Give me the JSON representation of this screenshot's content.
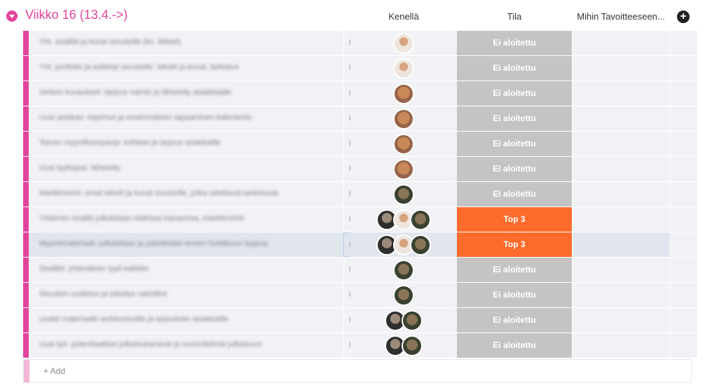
{
  "group": {
    "title": "Viikko 16 (13.4.->)"
  },
  "columns": {
    "person": "Kenellä",
    "status": "Tila",
    "goal": "Mihin Tavoitteeseen..."
  },
  "rows": [
    {
      "name": "Yht. sisällöt ja kuvat sivustolle (ks. liitteet)",
      "avatars": [
        "av-a"
      ],
      "status": "Ei aloitettu",
      "status_type": "default",
      "selected": false
    },
    {
      "name": "Yht. portfolio ja esittelyt sivustolle: tekstit ja kuvat, tarkistus",
      "avatars": [
        "av-a"
      ],
      "status": "Ei aloitettu",
      "status_type": "default",
      "selected": false
    },
    {
      "name": "Verkon kuvaukset: tarjous valmis ja lähetetty asiakkaalle",
      "avatars": [
        "av-b"
      ],
      "status": "Ei aloitettu",
      "status_type": "default",
      "selected": false
    },
    {
      "name": "Uusi asiakas: sopimus ja ensimmäinen tapaaminen kalenteriin",
      "avatars": [
        "av-b"
      ],
      "status": "Ei aloitettu",
      "status_type": "default",
      "selected": false
    },
    {
      "name": "Toinen myyntikampanja: kohteet ja tarjous asiakkaille",
      "avatars": [
        "av-b"
      ],
      "status": "Ei aloitettu",
      "status_type": "default",
      "selected": false
    },
    {
      "name": "Uusi tyyliopas: lähetetty",
      "avatars": [
        "av-b"
      ],
      "status": "Ei aloitettu",
      "status_type": "default",
      "selected": false
    },
    {
      "name": "Markkinointi: omat tekstit ja kuvat sivustolle, jotka odottavat tarkistusta",
      "avatars": [
        "av-c"
      ],
      "status": "Ei aloitettu",
      "status_type": "default",
      "selected": false
    },
    {
      "name": "Yhteinen sisältö julkaistaan kaikissa kanavissa, markkinointi",
      "avatars": [
        "av-d",
        "av-a",
        "av-c"
      ],
      "status": "Top 3",
      "status_type": "top",
      "selected": false
    },
    {
      "name": "Myyntimateriaali: julkaistaan ja päivitetään ennen huhtikuun loppua",
      "avatars": [
        "av-d",
        "av-a",
        "av-c"
      ],
      "status": "Top 3",
      "status_type": "top",
      "selected": true
    },
    {
      "name": "Sisällöt: yhtenäinen tyyli kaikkiin",
      "avatars": [
        "av-c"
      ],
      "status": "Ei aloitettu",
      "status_type": "default",
      "selected": false
    },
    {
      "name": "Sivuston uudistus ja päivitys valmiiksi",
      "avatars": [
        "av-c"
      ],
      "status": "Ei aloitettu",
      "status_type": "default",
      "selected": false
    },
    {
      "name": "Uudet materiaalit verkkosivuille ja tarjouksiin asiakkaille",
      "avatars": [
        "av-d",
        "av-c"
      ],
      "status": "Ei aloitettu",
      "status_type": "default",
      "selected": false
    },
    {
      "name": "Uusi työ: potentiaaliset julkaisukanavat ja suunnitelmat julkaisuun",
      "avatars": [
        "av-d",
        "av-c"
      ],
      "status": "Ei aloitettu",
      "status_type": "default",
      "selected": false
    }
  ],
  "add_row": {
    "placeholder": "+ Add"
  },
  "colors": {
    "group": "#e2449d",
    "status_default": "#c4c4c4",
    "status_top": "#fe6b2c"
  },
  "icons": {
    "toggle": "chevron-down-icon",
    "add_column": "plus-circle-icon",
    "updates": "chat-bubble-icon"
  }
}
